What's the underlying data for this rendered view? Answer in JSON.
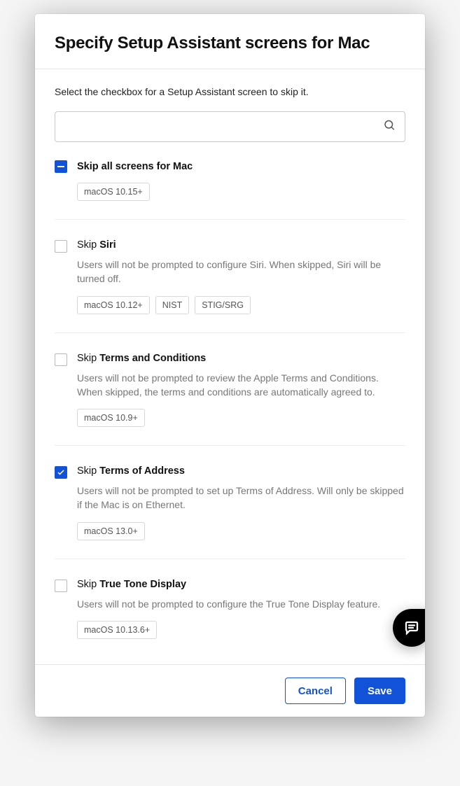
{
  "header": {
    "title": "Specify Setup Assistant screens for Mac"
  },
  "instruction": "Select the checkbox for a Setup Assistant screen to skip it.",
  "search": {
    "placeholder": ""
  },
  "skip_all": {
    "label": "Skip all screens for Mac",
    "state": "indeterminate"
  },
  "items": {
    "partial": {
      "tag0": "macOS 10.15+"
    },
    "siri": {
      "prefix": "Skip ",
      "name": "Siri",
      "desc": "Users will not be prompted to configure Siri. When skipped, Siri will be turned off.",
      "tag0": "macOS 10.12+",
      "tag1": "NIST",
      "tag2": "STIG/SRG",
      "checked": false
    },
    "terms_conditions": {
      "prefix": "Skip ",
      "name": "Terms and Conditions",
      "desc": "Users will not be prompted to review the Apple Terms and Conditions. When skipped, the terms and conditions are automatically agreed to.",
      "tag0": "macOS 10.9+",
      "checked": false
    },
    "terms_address": {
      "prefix": "Skip ",
      "name": "Terms of Address",
      "desc": "Users will not be prompted to set up Terms of Address. Will only be skipped if the Mac is on Ethernet.",
      "tag0": "macOS 13.0+",
      "checked": true
    },
    "truetone": {
      "prefix": "Skip ",
      "name": "True Tone Display",
      "desc": "Users will not be prompted to configure the True Tone Display feature.",
      "tag0": "macOS 10.13.6+",
      "checked": false
    }
  },
  "footer": {
    "cancel": "Cancel",
    "save": "Save"
  }
}
